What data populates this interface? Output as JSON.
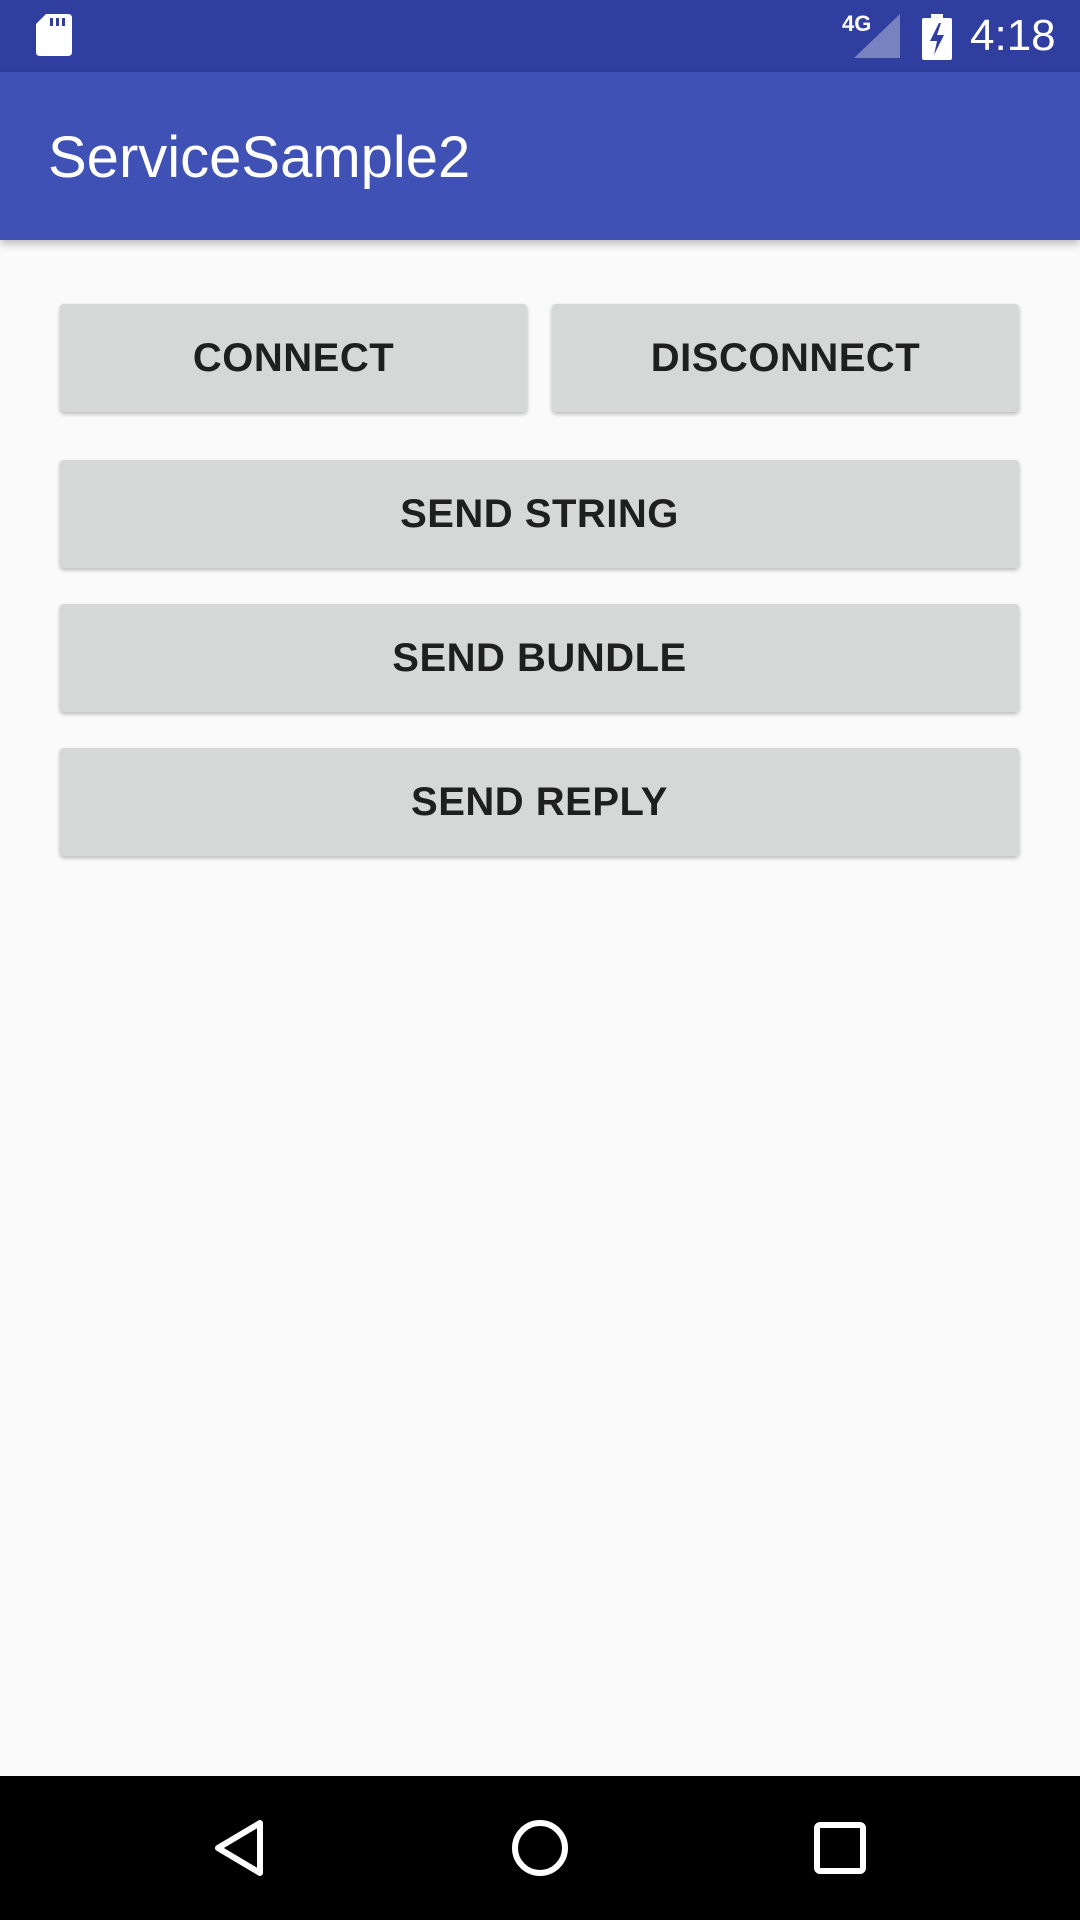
{
  "status_bar": {
    "network_type": "4G",
    "time": "4:18",
    "icons": [
      "sd-card-icon",
      "cellular-signal-icon",
      "battery-charging-icon"
    ]
  },
  "app_bar": {
    "title": "ServiceSample2"
  },
  "buttons": {
    "connect": "CONNECT",
    "disconnect": "DISCONNECT",
    "send_string": "SEND STRING",
    "send_bundle": "SEND BUNDLE",
    "send_reply": "SEND REPLY"
  },
  "nav_bar": {
    "icons": [
      "back-icon",
      "home-icon",
      "recents-icon"
    ]
  },
  "colors": {
    "status_bar": "#303f9f",
    "app_bar": "#3f51b5",
    "background": "#fafafa",
    "button": "#d6d7d7",
    "button_text": "#1f1f1f",
    "nav_bar": "#000000"
  }
}
